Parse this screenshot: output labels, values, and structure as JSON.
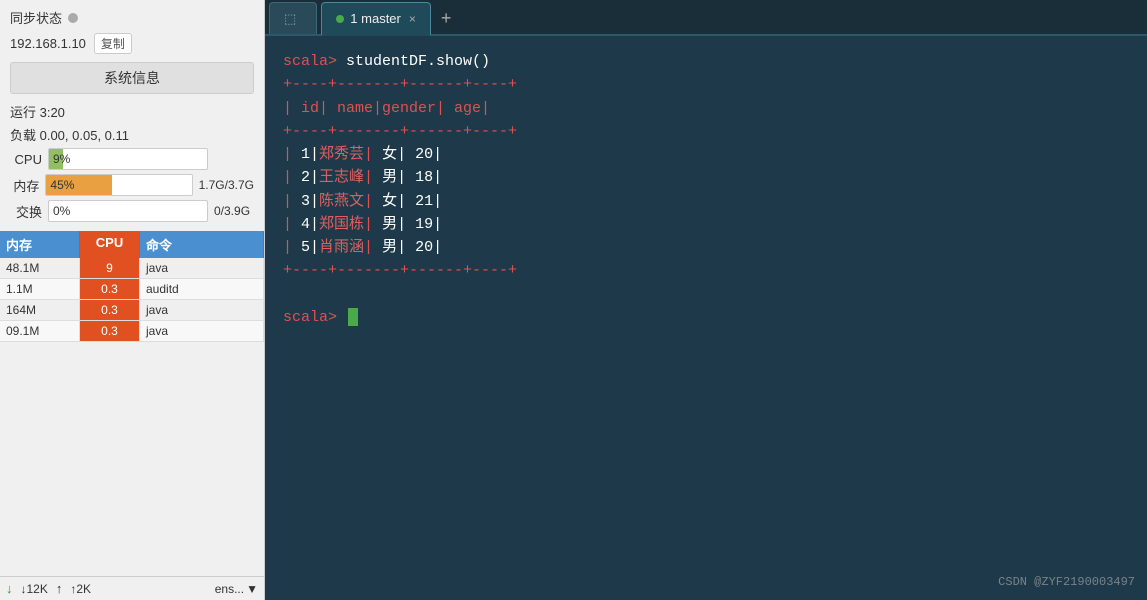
{
  "left": {
    "sync_label": "同步状态",
    "ip_label": "192.168.1.10",
    "copy_label": "复制",
    "sys_info_label": "系统信息",
    "uptime_label": "运行 3:20",
    "load_label": "负载 0.00, 0.05, 0.11",
    "cpu_label": "CPU",
    "cpu_percent": "9%",
    "cpu_bar_pct": 9,
    "mem_label": "内存",
    "mem_percent": "45%",
    "mem_detail": "1.7G/3.7G",
    "mem_bar_pct": 45,
    "swap_label": "交换",
    "swap_percent": "0%",
    "swap_detail": "0/3.9G",
    "swap_bar_pct": 0,
    "table_headers": {
      "mem": "内存",
      "cpu": "CPU",
      "cmd": "命令"
    },
    "processes": [
      {
        "mem": "48.1M",
        "cpu": "9",
        "cmd": "java"
      },
      {
        "mem": "1.1M",
        "cpu": "0.3",
        "cmd": "auditd"
      },
      {
        "mem": "164M",
        "cpu": "0.3",
        "cmd": "java"
      },
      {
        "mem": "09.1M",
        "cpu": "0.3",
        "cmd": "java"
      }
    ],
    "net_down": "↓12K",
    "net_up": "↑2K",
    "ensemble": "ens..."
  },
  "tabs": {
    "inactive": {
      "icon": "⬚",
      "label": ""
    },
    "active": {
      "dot_color": "#4aaa4a",
      "label": "1 master",
      "close": "×"
    },
    "add": "+"
  },
  "terminal": {
    "prompt1": "scala>",
    "cmd1": " studentDF.show()",
    "separator": "+----+-------+------+----+",
    "header": "|  id|   name|gender| age|",
    "rows": [
      {
        "id": "    1",
        "name": "郑秀芸",
        "gender": "      女",
        "age": "20"
      },
      {
        "id": "    2",
        "name": "王志峰",
        "gender": "      男",
        "age": "18"
      },
      {
        "id": "    3",
        "name": "陈燕文",
        "gender": "      女",
        "age": "21"
      },
      {
        "id": "    4",
        "name": "郑国栋",
        "gender": "      男",
        "age": "19"
      },
      {
        "id": "    5",
        "name": "肖雨涵",
        "gender": "      男",
        "age": "20"
      }
    ],
    "prompt2": "scala>",
    "watermark": "CSDN @ZYF2190003497"
  }
}
